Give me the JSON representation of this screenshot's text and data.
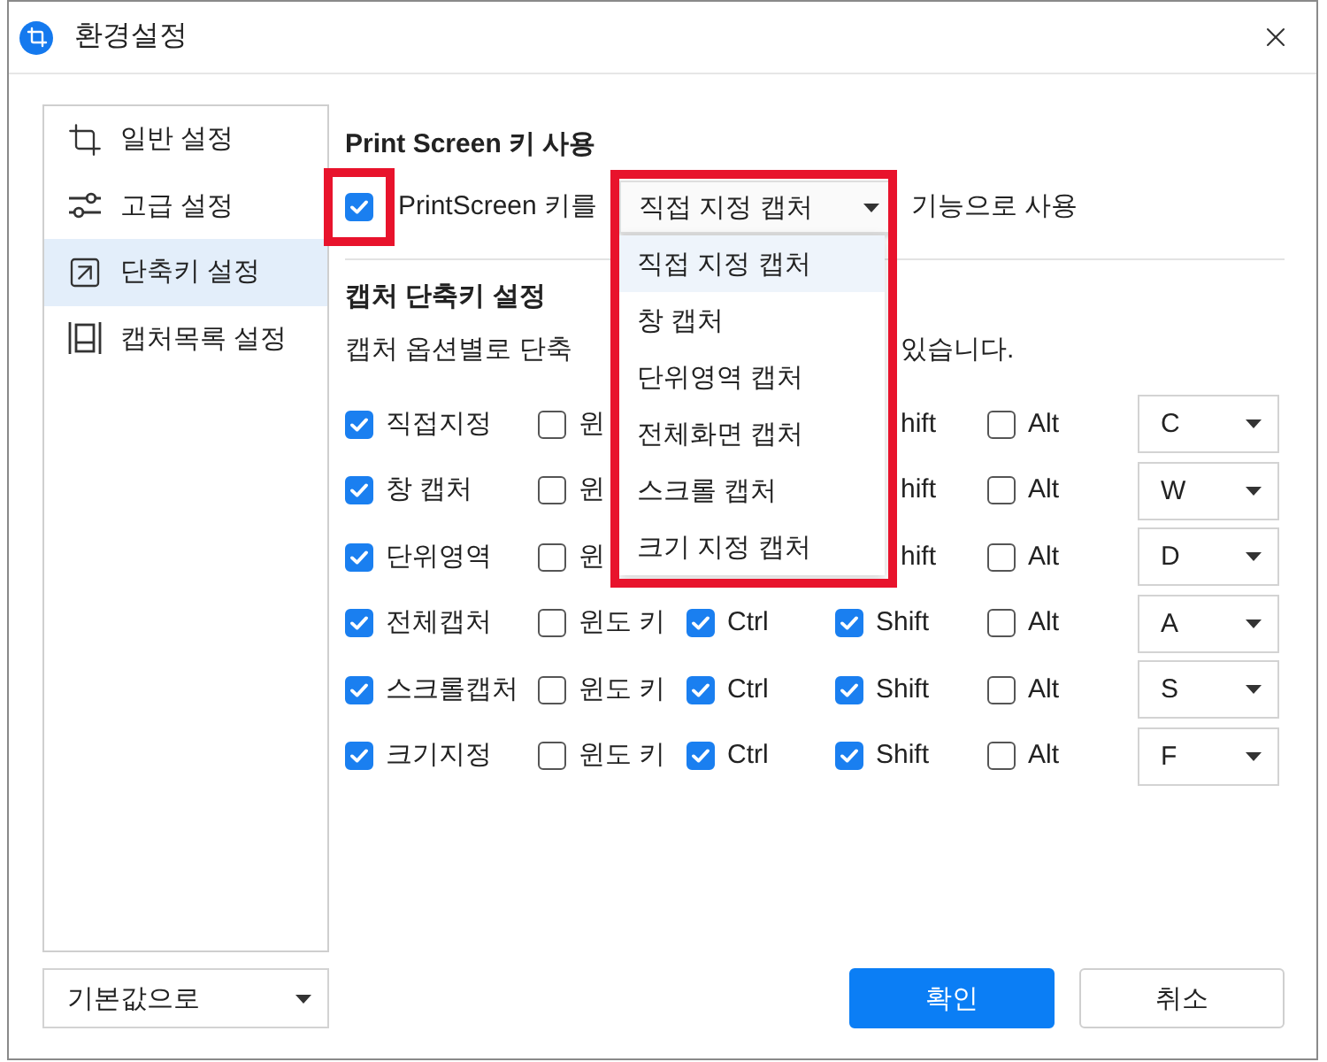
{
  "window": {
    "title": "환경설정"
  },
  "sidebar": {
    "items": [
      {
        "label": "일반 설정",
        "selected": false
      },
      {
        "label": "고급 설정",
        "selected": false
      },
      {
        "label": "단축키 설정",
        "selected": true
      },
      {
        "label": "캡처목록 설정",
        "selected": false
      }
    ]
  },
  "printscreen": {
    "heading": "Print Screen 키 사용",
    "checked": true,
    "highlighted": true,
    "label": "PrintScreen 키를",
    "select": {
      "value": "직접 지정 캡처",
      "highlighted": true,
      "expanded": true,
      "options": [
        {
          "label": "직접 지정 캡처",
          "selected": true
        },
        {
          "label": "창 캡처",
          "selected": false
        },
        {
          "label": "단위영역 캡처",
          "selected": false
        },
        {
          "label": "전체화면 캡처",
          "selected": false
        },
        {
          "label": "스크롤 캡처",
          "selected": false
        },
        {
          "label": "크기 지정 캡처",
          "selected": false
        }
      ]
    },
    "suffix": "기능으로 사용"
  },
  "shortcut_settings": {
    "heading": "캡처 단축키 설정",
    "description_parts": [
      "캡처 옵션별로 단축",
      "있습니다."
    ]
  },
  "shortcuts": [
    {
      "enabled": true,
      "name": "직접지정",
      "win": {
        "checked": false,
        "label": "윈"
      },
      "shift": {
        "label": "hift"
      },
      "alt": {
        "checked": false,
        "label": "Alt"
      },
      "key": "C"
    },
    {
      "enabled": true,
      "name": "창 캡처",
      "win": {
        "checked": false,
        "label": "윈"
      },
      "shift": {
        "label": "hift"
      },
      "alt": {
        "checked": false,
        "label": "Alt"
      },
      "key": "W"
    },
    {
      "enabled": true,
      "name": "단위영역",
      "win": {
        "checked": false,
        "label": "윈"
      },
      "shift": {
        "label": "hift"
      },
      "alt": {
        "checked": false,
        "label": "Alt"
      },
      "key": "D"
    },
    {
      "enabled": true,
      "name": "전체캡처",
      "win": {
        "checked": false,
        "label": "윈도 키"
      },
      "ctrl": {
        "checked": true,
        "label": "Ctrl"
      },
      "shift": {
        "checked": true,
        "label": "Shift"
      },
      "alt": {
        "checked": false,
        "label": "Alt"
      },
      "key": "A"
    },
    {
      "enabled": true,
      "name": "스크롤캡처",
      "win": {
        "checked": false,
        "label": "윈도 키"
      },
      "ctrl": {
        "checked": true,
        "label": "Ctrl"
      },
      "shift": {
        "checked": true,
        "label": "Shift"
      },
      "alt": {
        "checked": false,
        "label": "Alt"
      },
      "key": "S"
    },
    {
      "enabled": true,
      "name": "크기지정",
      "win": {
        "checked": false,
        "label": "윈도 키"
      },
      "ctrl": {
        "checked": true,
        "label": "Ctrl"
      },
      "shift": {
        "checked": true,
        "label": "Shift"
      },
      "alt": {
        "checked": false,
        "label": "Alt"
      },
      "key": "F"
    }
  ],
  "footer": {
    "reset_select": "기본값으로",
    "buttons": [
      {
        "kind": "primary",
        "label": "확인"
      },
      {
        "kind": "secondary",
        "label": "취소"
      }
    ]
  }
}
